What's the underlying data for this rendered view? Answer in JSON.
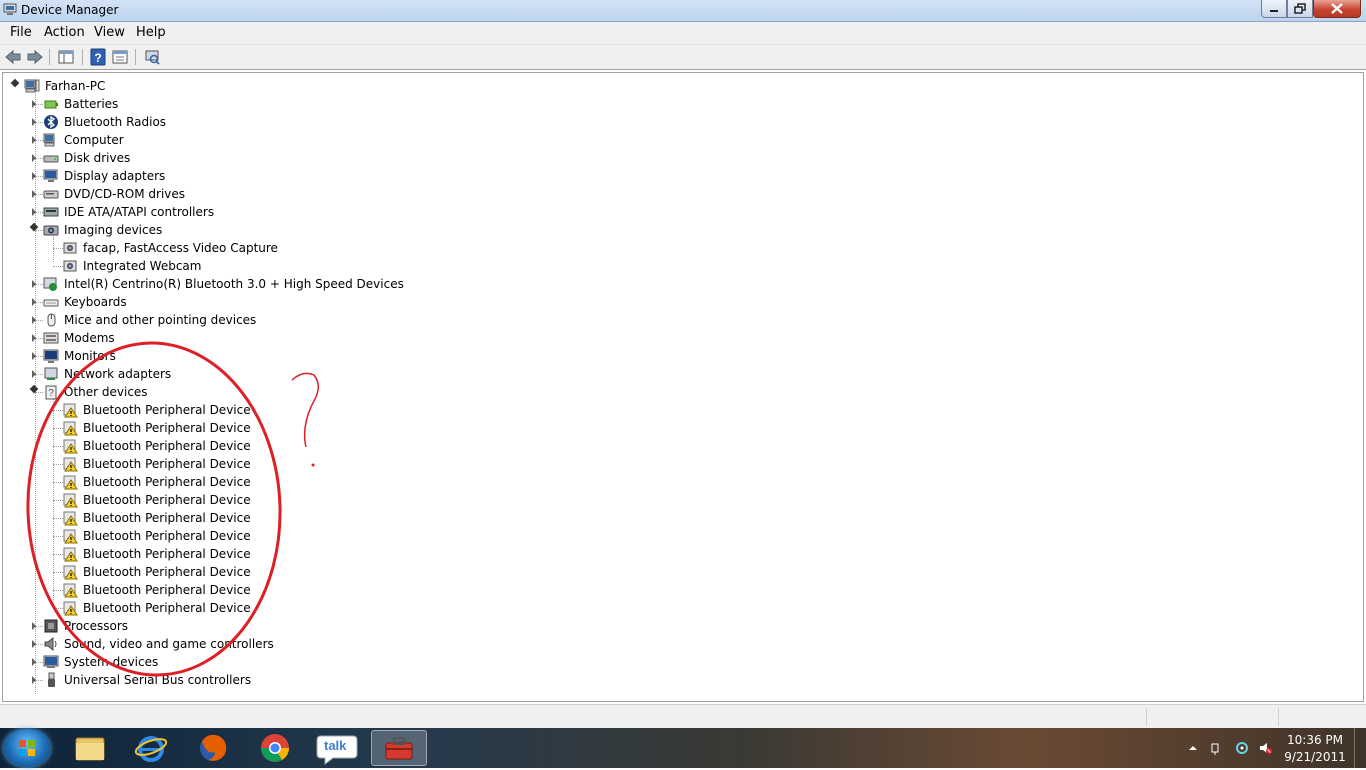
{
  "window": {
    "title": "Device Manager"
  },
  "menu": {
    "file": "File",
    "action": "Action",
    "view": "View",
    "help": "Help"
  },
  "tree": {
    "root": "Farhan-PC",
    "items": [
      "Batteries",
      "Bluetooth Radios",
      "Computer",
      "Disk drives",
      "Display adapters",
      "DVD/CD-ROM drives",
      "IDE ATA/ATAPI controllers",
      "Imaging devices",
      "facap, FastAccess Video Capture",
      "Integrated Webcam",
      "Intel(R) Centrino(R) Bluetooth 3.0 + High Speed Devices",
      "Keyboards",
      "Mice and other pointing devices",
      "Modems",
      "Monitors",
      "Network adapters",
      "Other devices",
      "Bluetooth Peripheral Device",
      "Bluetooth Peripheral Device",
      "Bluetooth Peripheral Device",
      "Bluetooth Peripheral Device",
      "Bluetooth Peripheral Device",
      "Bluetooth Peripheral Device",
      "Bluetooth Peripheral Device",
      "Bluetooth Peripheral Device",
      "Bluetooth Peripheral Device",
      "Bluetooth Peripheral Device",
      "Bluetooth Peripheral Device",
      "Bluetooth Peripheral Device",
      "Processors",
      "Sound, video and game controllers",
      "System devices",
      "Universal Serial Bus controllers"
    ]
  },
  "taskbar": {
    "time": "10:36 PM",
    "date": "9/21/2011",
    "talk_label": "talk"
  }
}
